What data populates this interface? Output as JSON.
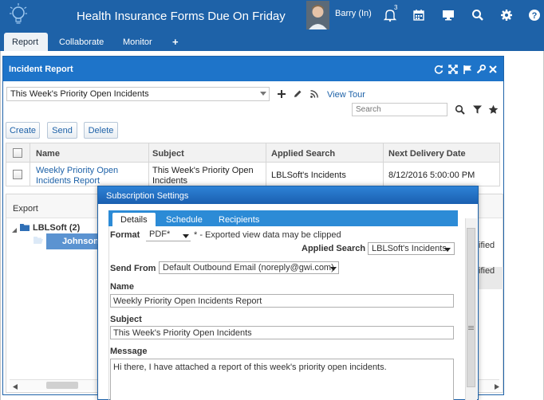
{
  "header": {
    "title": "Health Insurance Forms Due On Friday",
    "user": "Barry (In)",
    "notification_count": "3",
    "icons": [
      "lightbulb-logo",
      "bell-icon",
      "calendar-icon",
      "monitor-icon",
      "search-icon",
      "gear-icon",
      "help-icon"
    ]
  },
  "tabs": [
    {
      "label": "Report",
      "active": true
    },
    {
      "label": "Collaborate"
    },
    {
      "label": "Monitor"
    },
    {
      "label": "+"
    }
  ],
  "panel": {
    "title": "Incident Report",
    "header_icons": [
      "refresh-icon",
      "expand-icon",
      "flag-icon",
      "wrench-icon",
      "close-icon"
    ],
    "view_select": "This Week's Priority Open Incidents",
    "view_tour": "View Tour",
    "search_placeholder": "Search",
    "buttons": {
      "create": "Create",
      "send": "Send",
      "delete": "Delete"
    },
    "columns": [
      "Name",
      "Subject",
      "Applied Search",
      "Next Delivery Date"
    ],
    "rows": [
      {
        "name": "Weekly Priority Open Incidents Report",
        "subject": "This Week's Priority Open Incidents",
        "applied_search": "LBLSoft's Incidents",
        "next_delivery": "8/12/2016 5:00:00 PM"
      }
    ]
  },
  "export": {
    "label": "Export",
    "tree_root": "LBLSoft (2)",
    "tree_child": "Johnson, Steve",
    "right_col_1": "ified",
    "right_col_2": "ified"
  },
  "dialog": {
    "title": "Subscription Settings",
    "tabs": [
      "Details",
      "Schedule",
      "Recipients"
    ],
    "format_label": "Format",
    "format_value": "PDF*",
    "format_note": "* - Exported view data may be clipped",
    "applied_search_label": "Applied Search",
    "applied_search_value": "LBLSoft's Incidents",
    "send_from_label": "Send From",
    "send_from_value": "Default Outbound Email (noreply@gwi.com)",
    "name_label": "Name",
    "name_value": "Weekly Priority Open Incidents Report",
    "subject_label": "Subject",
    "subject_value": "This Week's Priority Open Incidents",
    "message_label": "Message",
    "message_value": "Hi there, I have attached a report of this week's priority open incidents."
  },
  "colors": {
    "brand": "#1e62a8",
    "panel_header": "#1e74c9",
    "tab_strip": "#2c8bd6",
    "link": "#1e62a8",
    "selected_tree": "#5b93d1"
  }
}
